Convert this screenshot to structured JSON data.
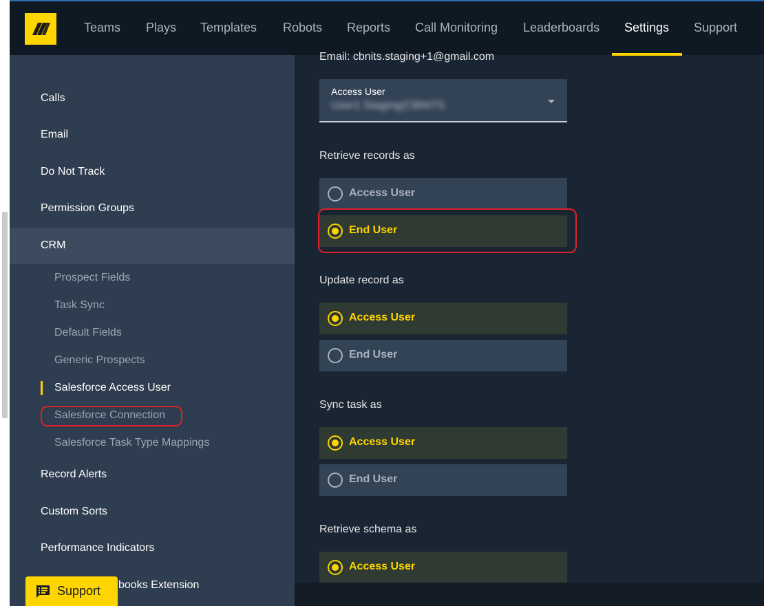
{
  "topnav": {
    "items": [
      {
        "label": "Teams"
      },
      {
        "label": "Plays"
      },
      {
        "label": "Templates"
      },
      {
        "label": "Robots"
      },
      {
        "label": "Reports"
      },
      {
        "label": "Call Monitoring"
      },
      {
        "label": "Leaderboards"
      },
      {
        "label": "Settings",
        "active": true
      },
      {
        "label": "Support"
      }
    ],
    "accent_color": "#ffd500"
  },
  "sidebar": {
    "items": [
      {
        "label": "Calls"
      },
      {
        "label": "Email"
      },
      {
        "label": "Do Not Track"
      },
      {
        "label": "Permission Groups"
      },
      {
        "label": "CRM",
        "expanded": true
      },
      {
        "label": "Record Alerts"
      },
      {
        "label": "Custom Sorts"
      },
      {
        "label": "Performance Indicators"
      },
      {
        "label": "books Extension"
      }
    ],
    "crm_subitems": [
      {
        "label": "Prospect Fields"
      },
      {
        "label": "Task Sync"
      },
      {
        "label": "Default Fields"
      },
      {
        "label": "Generic Prospects"
      },
      {
        "label": "Salesforce Access User",
        "active": true
      },
      {
        "label": "Salesforce Connection"
      },
      {
        "label": "Salesforce Task Type Mappings"
      }
    ]
  },
  "support_button": {
    "label": "Support",
    "icon": "feedback-icon"
  },
  "main": {
    "email_line": "Email: cbnits.staging+1@gmail.com",
    "access_user_select": {
      "label": "Access User",
      "value": "User1 Staging(CBNITS"
    },
    "sections": [
      {
        "title": "Retrieve records as",
        "options": [
          {
            "label": "Access User",
            "selected": false
          },
          {
            "label": "End User",
            "selected": true
          }
        ]
      },
      {
        "title": "Update record as",
        "options": [
          {
            "label": "Access User",
            "selected": true
          },
          {
            "label": "End User",
            "selected": false
          }
        ]
      },
      {
        "title": "Sync task as",
        "options": [
          {
            "label": "Access User",
            "selected": true
          },
          {
            "label": "End User",
            "selected": false
          }
        ]
      },
      {
        "title": "Retrieve schema as",
        "options": [
          {
            "label": "Access User",
            "selected": true
          }
        ]
      }
    ]
  },
  "colors": {
    "sidebar_bg": "#2e3d4f",
    "main_bg": "#1a2533",
    "topbar_bg": "#0f1923",
    "highlight_red": "#e0202a"
  }
}
